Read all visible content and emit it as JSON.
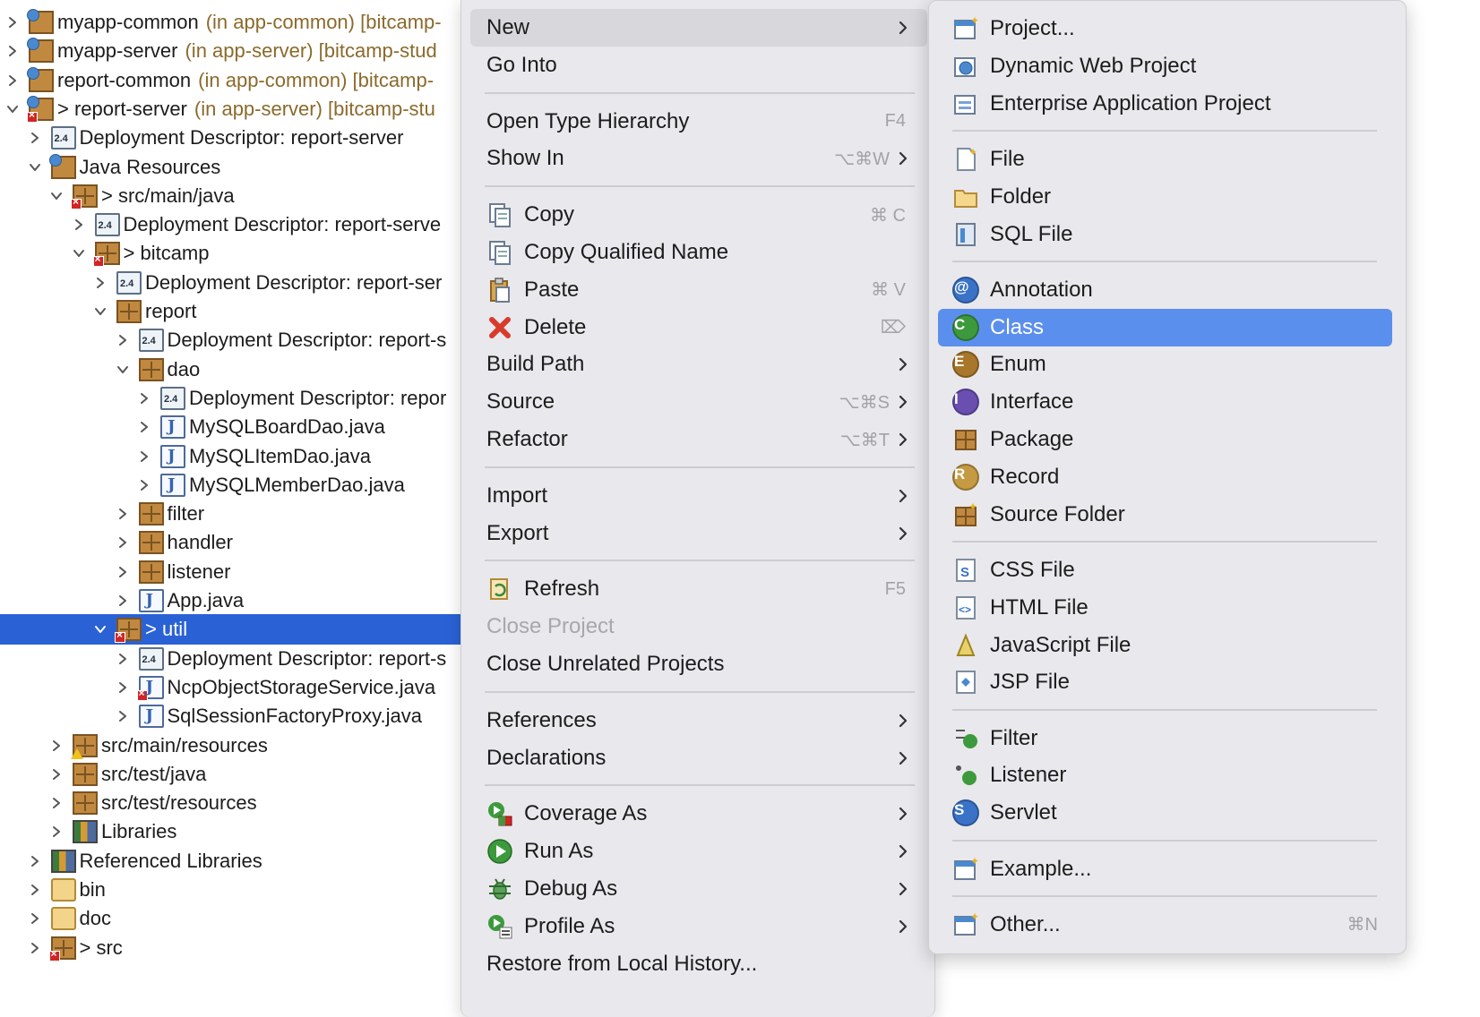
{
  "tree": [
    {
      "label": "myapp-common",
      "deco": "(in app-common) [bitcamp-",
      "indent": 0,
      "expanded": false,
      "icon": "project-icon"
    },
    {
      "label": "myapp-server",
      "deco": "(in app-server) [bitcamp-stud",
      "indent": 0,
      "expanded": false,
      "icon": "project-icon"
    },
    {
      "label": "report-common",
      "deco": "(in app-common) [bitcamp-",
      "indent": 0,
      "expanded": false,
      "icon": "project-icon"
    },
    {
      "label": "> report-server",
      "deco": "(in app-server) [bitcamp-stu",
      "indent": 0,
      "expanded": true,
      "icon": "project-icon"
    },
    {
      "label": "Deployment Descriptor: report-server",
      "deco": "",
      "indent": 1,
      "expanded": false,
      "icon": "descriptor-icon"
    },
    {
      "label": "Java Resources",
      "deco": "",
      "indent": 1,
      "expanded": true,
      "icon": "java-resources-icon"
    },
    {
      "label": "> src/main/java",
      "deco": "",
      "indent": 2,
      "expanded": true,
      "icon": "source-folder-icon"
    },
    {
      "label": "Deployment Descriptor: report-serve",
      "deco": "",
      "indent": 3,
      "expanded": false,
      "icon": "descriptor-icon"
    },
    {
      "label": "> bitcamp",
      "deco": "",
      "indent": 3,
      "expanded": true,
      "icon": "package-icon"
    },
    {
      "label": "Deployment Descriptor: report-ser",
      "deco": "",
      "indent": 4,
      "expanded": false,
      "icon": "descriptor-icon"
    },
    {
      "label": "report",
      "deco": "",
      "indent": 4,
      "expanded": true,
      "icon": "package-icon"
    },
    {
      "label": "Deployment Descriptor: report-s",
      "deco": "",
      "indent": 5,
      "expanded": false,
      "icon": "descriptor-icon"
    },
    {
      "label": "dao",
      "deco": "",
      "indent": 5,
      "expanded": true,
      "icon": "package-icon"
    },
    {
      "label": "Deployment Descriptor: repor",
      "deco": "",
      "indent": 6,
      "expanded": false,
      "icon": "descriptor-icon"
    },
    {
      "label": "MySQLBoardDao.java",
      "deco": "",
      "indent": 6,
      "expanded": false,
      "icon": "java-file-icon"
    },
    {
      "label": "MySQLItemDao.java",
      "deco": "",
      "indent": 6,
      "expanded": false,
      "icon": "java-file-icon"
    },
    {
      "label": "MySQLMemberDao.java",
      "deco": "",
      "indent": 6,
      "expanded": false,
      "icon": "java-file-icon"
    },
    {
      "label": "filter",
      "deco": "",
      "indent": 5,
      "expanded": false,
      "icon": "package-icon"
    },
    {
      "label": "handler",
      "deco": "",
      "indent": 5,
      "expanded": false,
      "icon": "package-icon"
    },
    {
      "label": "listener",
      "deco": "",
      "indent": 5,
      "expanded": false,
      "icon": "package-icon"
    },
    {
      "label": "App.java",
      "deco": "",
      "indent": 5,
      "expanded": false,
      "icon": "java-file-icon"
    },
    {
      "label": "> util",
      "deco": "",
      "indent": 4,
      "expanded": true,
      "icon": "package-icon",
      "selected": true
    },
    {
      "label": "Deployment Descriptor: report-s",
      "deco": "",
      "indent": 5,
      "expanded": false,
      "icon": "descriptor-icon"
    },
    {
      "label": "NcpObjectStorageService.java",
      "deco": "",
      "indent": 5,
      "expanded": false,
      "icon": "java-file-error-icon"
    },
    {
      "label": "SqlSessionFactoryProxy.java",
      "deco": "",
      "indent": 5,
      "expanded": false,
      "icon": "java-file-icon"
    },
    {
      "label": "src/main/resources",
      "deco": "",
      "indent": 2,
      "expanded": false,
      "icon": "source-folder-icon"
    },
    {
      "label": "src/test/java",
      "deco": "",
      "indent": 2,
      "expanded": false,
      "icon": "source-folder-icon"
    },
    {
      "label": "src/test/resources",
      "deco": "",
      "indent": 2,
      "expanded": false,
      "icon": "source-folder-icon"
    },
    {
      "label": "Libraries",
      "deco": "",
      "indent": 2,
      "expanded": false,
      "icon": "libraries-icon"
    },
    {
      "label": "Referenced Libraries",
      "deco": "",
      "indent": 1,
      "expanded": false,
      "icon": "libraries-icon"
    },
    {
      "label": "bin",
      "deco": "",
      "indent": 1,
      "expanded": false,
      "icon": "folder-icon"
    },
    {
      "label": "doc",
      "deco": "",
      "indent": 1,
      "expanded": false,
      "icon": "folder-icon"
    },
    {
      "label": "> src",
      "deco": "",
      "indent": 1,
      "expanded": false,
      "icon": "package-icon"
    }
  ],
  "context_menu": [
    {
      "type": "item",
      "label": "New",
      "shortcut": "",
      "submenu": true,
      "icon": "",
      "highlighted": true
    },
    {
      "type": "item",
      "label": "Go Into",
      "shortcut": "",
      "submenu": false,
      "icon": ""
    },
    {
      "type": "sep"
    },
    {
      "type": "item",
      "label": "Open Type Hierarchy",
      "shortcut": "F4",
      "submenu": false,
      "icon": ""
    },
    {
      "type": "item",
      "label": "Show In",
      "shortcut": "⌥⌘W",
      "submenu": true,
      "icon": ""
    },
    {
      "type": "sep"
    },
    {
      "type": "item",
      "label": "Copy",
      "shortcut": "⌘ C",
      "submenu": false,
      "icon": "copy-icon"
    },
    {
      "type": "item",
      "label": "Copy Qualified Name",
      "shortcut": "",
      "submenu": false,
      "icon": "copy-qualified-name-icon"
    },
    {
      "type": "item",
      "label": "Paste",
      "shortcut": "⌘ V",
      "submenu": false,
      "icon": "paste-icon"
    },
    {
      "type": "item",
      "label": "Delete",
      "shortcut": "⌦",
      "submenu": false,
      "icon": "delete-icon"
    },
    {
      "type": "item",
      "label": "Build Path",
      "shortcut": "",
      "submenu": true,
      "icon": ""
    },
    {
      "type": "item",
      "label": "Source",
      "shortcut": "⌥⌘S",
      "submenu": true,
      "icon": ""
    },
    {
      "type": "item",
      "label": "Refactor",
      "shortcut": "⌥⌘T",
      "submenu": true,
      "icon": ""
    },
    {
      "type": "sep"
    },
    {
      "type": "item",
      "label": "Import",
      "shortcut": "",
      "submenu": true,
      "icon": ""
    },
    {
      "type": "item",
      "label": "Export",
      "shortcut": "",
      "submenu": true,
      "icon": ""
    },
    {
      "type": "sep"
    },
    {
      "type": "item",
      "label": "Refresh",
      "shortcut": "F5",
      "submenu": false,
      "icon": "refresh-icon"
    },
    {
      "type": "item",
      "label": "Close Project",
      "shortcut": "",
      "submenu": false,
      "icon": "",
      "disabled": true
    },
    {
      "type": "item",
      "label": "Close Unrelated Projects",
      "shortcut": "",
      "submenu": false,
      "icon": ""
    },
    {
      "type": "sep"
    },
    {
      "type": "item",
      "label": "References",
      "shortcut": "",
      "submenu": true,
      "icon": ""
    },
    {
      "type": "item",
      "label": "Declarations",
      "shortcut": "",
      "submenu": true,
      "icon": ""
    },
    {
      "type": "sep"
    },
    {
      "type": "item",
      "label": "Coverage As",
      "shortcut": "",
      "submenu": true,
      "icon": "coverage-icon"
    },
    {
      "type": "item",
      "label": "Run As",
      "shortcut": "",
      "submenu": true,
      "icon": "run-icon"
    },
    {
      "type": "item",
      "label": "Debug As",
      "shortcut": "",
      "submenu": true,
      "icon": "debug-icon"
    },
    {
      "type": "item",
      "label": "Profile As",
      "shortcut": "",
      "submenu": true,
      "icon": "profile-icon"
    },
    {
      "type": "item",
      "label": "Restore from Local History...",
      "shortcut": "",
      "submenu": false,
      "icon": ""
    }
  ],
  "submenu": [
    {
      "type": "item",
      "label": "Project...",
      "icon": "project-wizard-icon",
      "shortcut": ""
    },
    {
      "type": "item",
      "label": "Dynamic Web Project",
      "icon": "dynamic-web-project-icon",
      "shortcut": ""
    },
    {
      "type": "item",
      "label": "Enterprise Application Project",
      "icon": "enterprise-project-icon",
      "shortcut": ""
    },
    {
      "type": "sep"
    },
    {
      "type": "item",
      "label": "File",
      "icon": "file-icon",
      "shortcut": ""
    },
    {
      "type": "item",
      "label": "Folder",
      "icon": "folder-icon",
      "shortcut": ""
    },
    {
      "type": "item",
      "label": "SQL File",
      "icon": "sql-file-icon",
      "shortcut": ""
    },
    {
      "type": "sep"
    },
    {
      "type": "item",
      "label": "Annotation",
      "icon": "annotation-icon",
      "shortcut": ""
    },
    {
      "type": "item",
      "label": "Class",
      "icon": "class-icon",
      "shortcut": "",
      "active": true
    },
    {
      "type": "item",
      "label": "Enum",
      "icon": "enum-icon",
      "shortcut": ""
    },
    {
      "type": "item",
      "label": "Interface",
      "icon": "interface-icon",
      "shortcut": ""
    },
    {
      "type": "item",
      "label": "Package",
      "icon": "package-icon",
      "shortcut": ""
    },
    {
      "type": "item",
      "label": "Record",
      "icon": "record-icon",
      "shortcut": ""
    },
    {
      "type": "item",
      "label": "Source Folder",
      "icon": "source-folder-icon",
      "shortcut": ""
    },
    {
      "type": "sep"
    },
    {
      "type": "item",
      "label": "CSS File",
      "icon": "css-file-icon",
      "shortcut": ""
    },
    {
      "type": "item",
      "label": "HTML File",
      "icon": "html-file-icon",
      "shortcut": ""
    },
    {
      "type": "item",
      "label": "JavaScript File",
      "icon": "javascript-file-icon",
      "shortcut": ""
    },
    {
      "type": "item",
      "label": "JSP File",
      "icon": "jsp-file-icon",
      "shortcut": ""
    },
    {
      "type": "sep"
    },
    {
      "type": "item",
      "label": "Filter",
      "icon": "filter-icon",
      "shortcut": ""
    },
    {
      "type": "item",
      "label": "Listener",
      "icon": "listener-icon",
      "shortcut": ""
    },
    {
      "type": "item",
      "label": "Servlet",
      "icon": "servlet-icon",
      "shortcut": ""
    },
    {
      "type": "sep"
    },
    {
      "type": "item",
      "label": "Example...",
      "icon": "example-icon",
      "shortcut": ""
    },
    {
      "type": "sep"
    },
    {
      "type": "item",
      "label": "Other...",
      "icon": "other-wizard-icon",
      "shortcut": "⌘N"
    }
  ],
  "colors": {
    "selection": "#2a62d6",
    "menu_bg": "#e9e8ec",
    "submenu_active": "#5b8fee",
    "decoration": "#8b6a2b"
  }
}
